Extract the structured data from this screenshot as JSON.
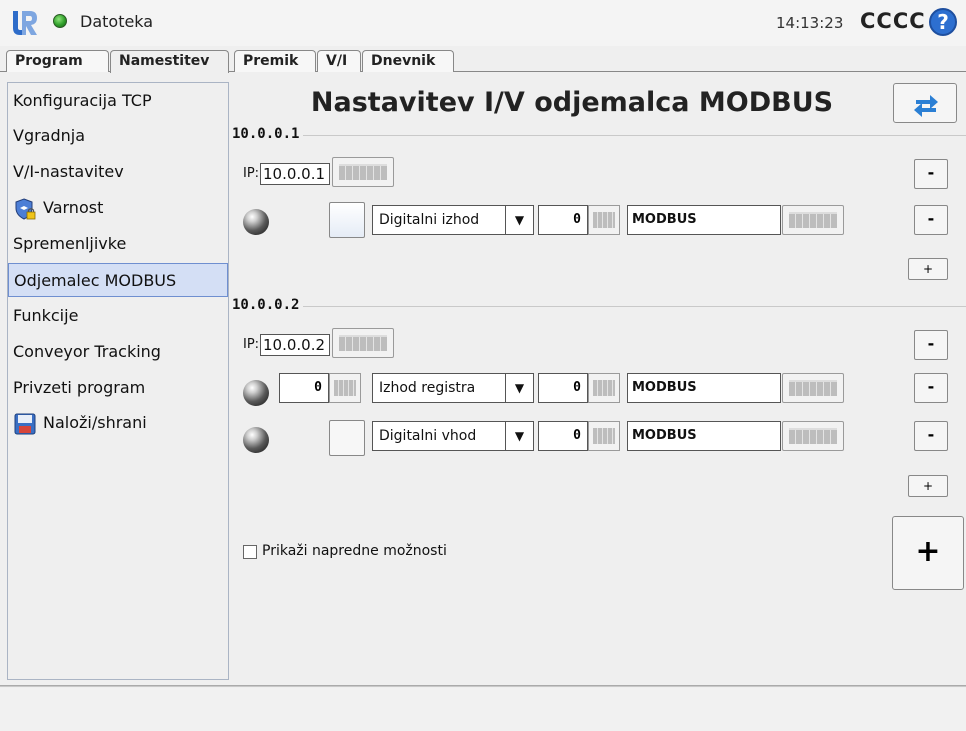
{
  "topbar": {
    "app_title": "Datoteka",
    "clock": "14:13:23",
    "robot_name": "CCCC",
    "help_label": "?"
  },
  "tabs": [
    {
      "label": "Program"
    },
    {
      "label": "Namestitev"
    },
    {
      "label": "Premik"
    },
    {
      "label": "V/I"
    },
    {
      "label": "Dnevnik"
    }
  ],
  "sidebar": {
    "items": [
      {
        "label": "Konfiguracija TCP"
      },
      {
        "label": "Vgradnja"
      },
      {
        "label": "V/I-nastavitev"
      },
      {
        "label": "Varnost"
      },
      {
        "label": "Spremenljivke"
      },
      {
        "label": "Odjemalec MODBUS"
      },
      {
        "label": "Funkcije"
      },
      {
        "label": "Conveyor Tracking"
      },
      {
        "label": "Privzeti program"
      },
      {
        "label": "Naloži/shrani"
      }
    ]
  },
  "main": {
    "title": "Nastavitev I/V odjemalca MODBUS",
    "ip_prefix": "IP:",
    "groups": [
      {
        "title": "10.0.0.1",
        "ip": "10.0.0.1",
        "signals": [
          {
            "address": "",
            "type": "Digitalni izhod",
            "register": "0",
            "name": "MODBUS"
          }
        ],
        "remove_label": "-",
        "add_label": "+"
      },
      {
        "title": "10.0.0.2",
        "ip": "10.0.0.2",
        "signals": [
          {
            "address": "0",
            "type": "Izhod registra",
            "register": "0",
            "name": "MODBUS"
          },
          {
            "address": "",
            "type": "Digitalni vhod",
            "register": "0",
            "name": "MODBUS"
          }
        ],
        "remove_label": "-",
        "add_label": "+"
      }
    ],
    "add_unit_label": "+",
    "advanced_label": "Prikaži napredne možnosti"
  }
}
